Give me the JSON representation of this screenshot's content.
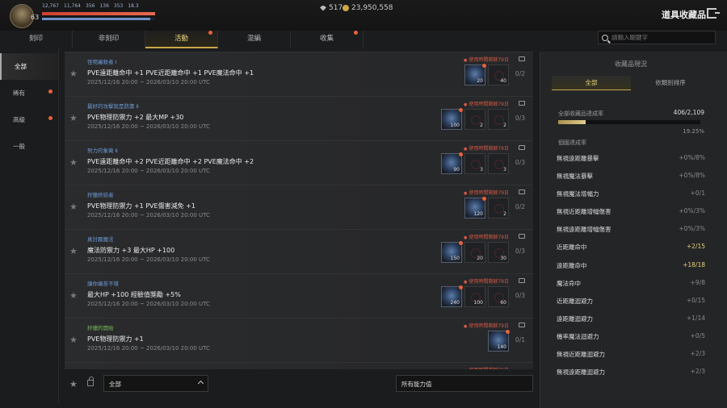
{
  "header": {
    "level": "63",
    "stats": [
      "12,767",
      "11,764",
      "356",
      "136",
      "353",
      "18.3"
    ],
    "currency1": "517",
    "currency2": "23,950,558",
    "title": "道具收藏品"
  },
  "tabs": [
    {
      "label": "刻印",
      "active": false,
      "badge": false
    },
    {
      "label": "非刻印",
      "active": false,
      "badge": false
    },
    {
      "label": "活動",
      "active": true,
      "badge": true
    },
    {
      "label": "混編",
      "active": false,
      "badge": false
    },
    {
      "label": "收集",
      "active": false,
      "badge": true
    }
  ],
  "search": {
    "placeholder": "請輸入關鍵字"
  },
  "sidebar": [
    {
      "label": "全部",
      "active": true,
      "badge": false
    },
    {
      "label": "稀有",
      "active": false,
      "badge": true
    },
    {
      "label": "高級",
      "active": false,
      "badge": true
    },
    {
      "label": "一般",
      "active": false,
      "badge": false
    }
  ],
  "rows": [
    {
      "name": "怪物屠殺者 Ⅰ",
      "color": "blue",
      "stat": "PVE遠距離命中 +1  PVE近距離命中 +1  PVE魔法命中 +1",
      "date": "2025/12/16 20:00 ~ 2026/03/10 20:00 UTC",
      "limit": "使用時間剩餘79日",
      "count": "0/2",
      "slots": [
        {
          "filled": true,
          "cnt": "20"
        },
        {
          "filled": false,
          "cnt": "40"
        }
      ]
    },
    {
      "name": "最好的攻擊就是防禦 Ⅱ",
      "color": "blue",
      "stat": "PVE物理防禦力 +2  最大MP +30",
      "date": "2025/12/16 20:00 ~ 2026/03/10 20:00 UTC",
      "limit": "使用時間剩餘79日",
      "count": "0/3",
      "slots": [
        {
          "filled": true,
          "cnt": "100"
        },
        {
          "filled": false,
          "cnt": "2"
        },
        {
          "filled": false,
          "cnt": "2"
        }
      ]
    },
    {
      "name": "努力的象徵 Ⅱ",
      "color": "blue",
      "stat": "PVE遠距離命中 +2  PVE近距離命中 +2  PVE魔法命中 +2",
      "date": "2025/12/16 20:00 ~ 2026/03/10 20:00 UTC",
      "limit": "使用時間剩餘79日",
      "count": "0/3",
      "slots": [
        {
          "filled": true,
          "cnt": "90"
        },
        {
          "filled": false,
          "cnt": "3"
        },
        {
          "filled": false,
          "cnt": "3"
        }
      ]
    },
    {
      "name": "狩獵終結者",
      "color": "blue",
      "stat": "PVE物理防禦力 +1  PVE傷害減免 +1",
      "date": "2025/12/16 20:00 ~ 2026/03/10 20:00 UTC",
      "limit": "使用時間剩餘79日",
      "count": "0/2",
      "slots": [
        {
          "filled": true,
          "cnt": "120"
        },
        {
          "filled": false,
          "cnt": "2"
        }
      ]
    },
    {
      "name": "真討厭魔法",
      "color": "blue",
      "stat": "魔法防禦力 +3  最大HP +100",
      "date": "2025/12/16 20:00 ~ 2026/03/10 20:00 UTC",
      "limit": "使用時間剩餘79日",
      "count": "0/3",
      "slots": [
        {
          "filled": true,
          "cnt": "150"
        },
        {
          "filled": false,
          "cnt": "20"
        },
        {
          "filled": false,
          "cnt": "30"
        }
      ]
    },
    {
      "name": "讓你痛苦不堪",
      "color": "blue",
      "stat": "最大HP +100  經驗值獎勵 +5%",
      "date": "2025/12/16 20:00 ~ 2026/03/10 20:00 UTC",
      "limit": "使用時間剩餘79日",
      "count": "0/3",
      "slots": [
        {
          "filled": true,
          "cnt": "240"
        },
        {
          "filled": false,
          "cnt": "100"
        },
        {
          "filled": false,
          "cnt": "60"
        }
      ]
    },
    {
      "name": "狩獵的開始",
      "color": "green",
      "stat": "PVE物理防禦力 +1",
      "date": "2025/12/16 20:00 ~ 2026/03/10 20:00 UTC",
      "limit": "使用時間剩餘79日",
      "count": "0/1",
      "slots": [
        {
          "filled": true,
          "cnt": "140"
        }
      ]
    }
  ],
  "last_limit": "使用時間剩餘79日",
  "filters": {
    "category": "全部",
    "ability": "所有能力值"
  },
  "panel": {
    "title": "收藏品現況",
    "tab_all": "全部",
    "tab_sort": "依類別排序",
    "rate_label": "全部收藏品達成率",
    "rate_value": "406/2,109",
    "rate_fraction": 0.1925,
    "rate_pct": "19.25%",
    "sub_label": "個國達成率",
    "stats": [
      {
        "name": "無視遠距離暴擊",
        "value": "+0%/8%",
        "hl": false
      },
      {
        "name": "無視魔法暴擊",
        "value": "+0%/8%",
        "hl": false
      },
      {
        "name": "無視魔法增幅力",
        "value": "+0/1",
        "hl": false
      },
      {
        "name": "無視近距離增幅傷害",
        "value": "+0%/3%",
        "hl": false
      },
      {
        "name": "無視遠距離增幅傷害",
        "value": "+0%/3%",
        "hl": false
      },
      {
        "name": "近距離命中",
        "value": "+2/15",
        "hl": true
      },
      {
        "name": "遠距離命中",
        "value": "+18/18",
        "hl": true
      },
      {
        "name": "魔法命中",
        "value": "+9/8",
        "hl": false
      },
      {
        "name": "近距離迴避力",
        "value": "+0/15",
        "hl": false
      },
      {
        "name": "遠距離迴避力",
        "value": "+1/14",
        "hl": false
      },
      {
        "name": "機率魔法迴避力",
        "value": "+0/5",
        "hl": false
      },
      {
        "name": "無視近距離迴避力",
        "value": "+2/3",
        "hl": false
      },
      {
        "name": "無視遠距離迴避力",
        "value": "+2/3",
        "hl": false
      }
    ]
  }
}
